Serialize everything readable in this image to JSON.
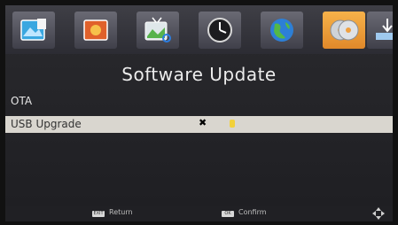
{
  "menu": {
    "icons": [
      "picture-icon",
      "photo-icon",
      "tv-search-icon",
      "clock-icon",
      "globe-icon",
      "discs-icon",
      "system-icon"
    ],
    "active_index": 5
  },
  "title": "Software Update",
  "items": [
    "OTA",
    "USB Upgrade"
  ],
  "selected_index": 1,
  "cursor_glyph": "✖",
  "footer": {
    "return_key": "EXIT",
    "return_label": "Return",
    "confirm_key": "OK",
    "confirm_label": "Confirm"
  }
}
